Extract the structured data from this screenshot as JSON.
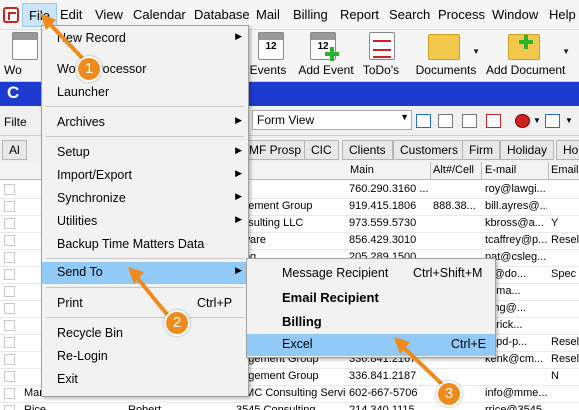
{
  "menubar": {
    "items": [
      {
        "label": "File"
      },
      {
        "label": "Edit"
      },
      {
        "label": "View"
      },
      {
        "label": "Calendar"
      },
      {
        "label": "Database"
      },
      {
        "label": "Mail"
      },
      {
        "label": "Billing"
      },
      {
        "label": "Report"
      },
      {
        "label": "Search"
      },
      {
        "label": "Process"
      },
      {
        "label": "Window"
      },
      {
        "label": "Help"
      }
    ]
  },
  "toolbar": {
    "buttons": [
      {
        "label": "Wo",
        "icon": "word-processor-icon"
      },
      {
        "label": "Events",
        "icon": "calendar-icon"
      },
      {
        "label": "Add Event",
        "icon": "calendar-add-icon"
      },
      {
        "label": "ToDo's",
        "icon": "todo-list-icon"
      },
      {
        "label": "Documents",
        "icon": "folder-icon"
      },
      {
        "label": "Add Document",
        "icon": "folder-add-icon"
      }
    ],
    "calendar_number": "12"
  },
  "title": "C",
  "filter": {
    "label": "Filte",
    "view_value": "Form View"
  },
  "tabs": [
    {
      "label": "Al"
    },
    {
      "label": "MF Prosp"
    },
    {
      "label": "CIC"
    },
    {
      "label": "Clients"
    },
    {
      "label": "Customers"
    },
    {
      "label": "Firm"
    },
    {
      "label": "Holiday"
    },
    {
      "label": "Hol"
    }
  ],
  "grid": {
    "columns": [
      "Main",
      "Alt#/Cell",
      "E-mail",
      "Email"
    ],
    "rows": [
      {
        "company": "",
        "main": "760.290.3160 ...",
        "alt": "",
        "email": "roy@lawgi...",
        "extra": ""
      },
      {
        "company": "agement Group",
        "main": "919.415.1806",
        "alt": "888.38...",
        "email": "bill.ayres@...",
        "extra": ""
      },
      {
        "company": "onsulting LLC",
        "main": "973.559.5730",
        "alt": "",
        "email": "kbross@a...",
        "extra": "Y"
      },
      {
        "company": "ftware",
        "main": "856.429.3010",
        "alt": "",
        "email": "tcaffrey@p...",
        "extra": "Resel"
      },
      {
        "company": "lting",
        "main": "205.289.1500",
        "alt": "",
        "email": "pat@csleg...",
        "extra": ""
      },
      {
        "company": "",
        "main": "",
        "alt": "",
        "email": "al@do...",
        "extra": "Spec"
      },
      {
        "company": "",
        "main": "",
        "alt": "",
        "email": "@ma...",
        "extra": ""
      },
      {
        "company": "",
        "main": "",
        "alt": "",
        "email": "ffing@...",
        "extra": ""
      },
      {
        "company": "",
        "main": "",
        "alt": "",
        "email": "@rick...",
        "extra": ""
      },
      {
        "company": "",
        "main": "",
        "alt": "",
        "email": "@pd-p...",
        "extra": "Resel"
      },
      {
        "company": "nagement Group",
        "main": "336.841.2167",
        "alt": "",
        "email": "kenk@cm...",
        "extra": "Resel"
      },
      {
        "company": "nagement Group",
        "main": "336.841.2187",
        "alt": "",
        "email": "",
        "extra": "N"
      },
      {
        "company": "MMC Consulting Services, ...",
        "main": "602-667-5706",
        "alt": "",
        "email": "info@mme...",
        "extra": "",
        "first": "Mark",
        "second": "Richard"
      },
      {
        "company": "3545 Consulting",
        "main": "214 340 1115",
        "alt": "",
        "email": "rrice@3545...",
        "extra": "",
        "first": "Rice",
        "second": "Robert"
      }
    ]
  },
  "file_menu": {
    "items": [
      {
        "label": "New Record",
        "submenu": true
      },
      {
        "label": "Word Processor"
      },
      {
        "label": "Launcher"
      },
      {
        "label": "Archives",
        "submenu": true
      },
      {
        "label": "Setup",
        "submenu": true
      },
      {
        "label": "Import/Export",
        "submenu": true
      },
      {
        "label": "Synchronize",
        "submenu": true
      },
      {
        "label": "Utilities",
        "submenu": true
      },
      {
        "label": "Backup Time Matters Data"
      },
      {
        "label": "Send To",
        "submenu": true
      },
      {
        "label": "Print",
        "shortcut": "Ctrl+P"
      },
      {
        "label": "Recycle Bin"
      },
      {
        "label": "Re-Login"
      },
      {
        "label": "Exit"
      }
    ]
  },
  "send_to_menu": {
    "items": [
      {
        "label": "Message Recipient",
        "shortcut": "Ctrl+Shift+M"
      },
      {
        "label": "Email Recipient"
      },
      {
        "label": "Billing"
      },
      {
        "label": "Excel",
        "shortcut": "Ctrl+E"
      }
    ]
  },
  "callouts": [
    "1",
    "2",
    "3"
  ],
  "colors": {
    "highlight": "#91c9f7",
    "title_bar": "#1e3bd0",
    "callout": "#f08a1c"
  }
}
